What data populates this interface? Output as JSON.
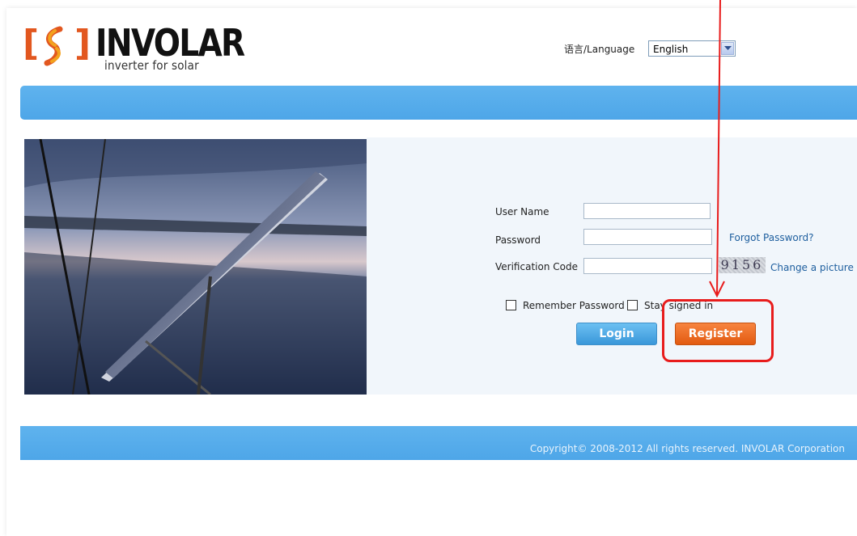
{
  "logo": {
    "bracket_left": "[",
    "bracket_right": "]",
    "brand": "INVOLAR",
    "tagline": "inverter for solar",
    "icon": "swirl-logo-icon"
  },
  "language": {
    "label": "语言/Language",
    "selected": "English",
    "icon": "chevron-down-icon"
  },
  "photo": {
    "description_icon": "solar-panel-photo"
  },
  "login": {
    "username_label": "User Name",
    "username_value": "",
    "password_label": "Password",
    "password_value": "",
    "forgot_password": "Forgot Password?",
    "verification_label": "Verification Code",
    "verification_value": "",
    "captcha_text": "9156",
    "change_picture": "Change a picture",
    "remember_password": "Remember Password",
    "stay_signed_in": "Stay signed in",
    "login_button": "Login",
    "register_button": "Register"
  },
  "footer": {
    "copyright": "Copyright© 2008-2012 All rights reserved. INVOLAR Corporation"
  },
  "colors": {
    "header_blue": "#4ea6e8",
    "register_orange": "#e25a10",
    "annotation_red": "#e81c1c"
  }
}
